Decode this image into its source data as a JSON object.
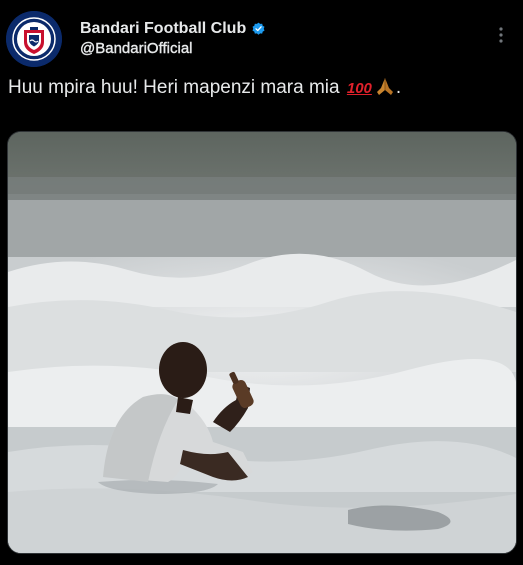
{
  "account": {
    "display_name": "Bandari Football Club",
    "handle": "@BandariOfficial",
    "verified": true,
    "avatar_icon": "club-crest-icon"
  },
  "tweet": {
    "text": "Huu mpira huu! Heri mapenzi mara mia",
    "emoji_100": "100",
    "emoji_pray_icon": "folded-hands-icon",
    "text_end": "."
  },
  "menu": {
    "icon": "more-vertical-icon"
  },
  "media": {
    "kind": "photo",
    "icon": "photo-icon"
  },
  "colors": {
    "background": "#000000",
    "text": "#e7e9ea",
    "verified_badge": "#1d9bf0",
    "crest_blue": "#0b2a6b",
    "emoji_red": "#e0212b"
  }
}
